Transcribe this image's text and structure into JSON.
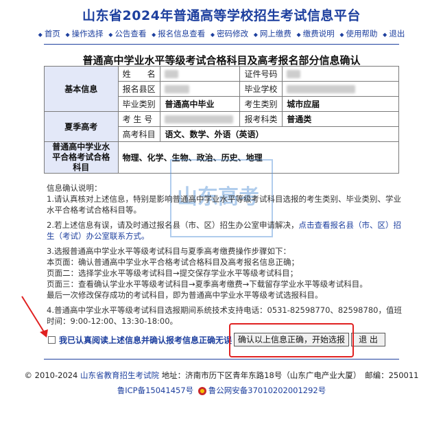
{
  "header": {
    "site_title": "山东省2024年普通高等学校招生考试信息平台",
    "nav": [
      "首页",
      "操作选择",
      "公告查看",
      "报名信息查看",
      "密码修改",
      "网上缴费",
      "缴费说明",
      "使用帮助",
      "退出"
    ]
  },
  "page_title": "普通高中学业水平等级考试合格科目及高考报名部分信息确认",
  "table": {
    "basic_section": "基本信息",
    "name_label": "姓　　名",
    "cert_label": "证件号码",
    "county_label": "报名县区",
    "school_label": "毕业学校",
    "grad_type_label": "毕业类别",
    "grad_type_value": "普通高中毕业",
    "exam_type_label": "考生类别",
    "exam_type_value": "城市应届",
    "summer_section": "夏季高考",
    "exam_no_label": "考 生 号",
    "subject_type_label": "报考科类",
    "subject_type_value": "普通类",
    "gaokao_subjects_label": "高考科目",
    "gaokao_subjects_value": "语文、数学、外语（英语）",
    "level_section": "普通高中学业水平合格考试合格科目",
    "level_subjects_value": "物理、化学、生物、政治、历史、地理"
  },
  "notes": {
    "title": "信息确认说明：",
    "n1": "1.请认真核对上述信息，特别是影响普通高中学业水平等级考试科目选报的考生类别、毕业类别、学业水平合格考试合格科目等。",
    "n2_text": "2.若上述信息有误，请及时通过报名县（市、区）招生办公室申请解决，",
    "n2_link": "点击查看报名县（市、区）招生（考试）办公室联系方式。",
    "n3_title": "3.选报普通高中学业水平等级考试科目与夏季高考缴费操作步骤如下：",
    "n3_p1": "本页面：确认普通高中学业水平合格考试合格科目及高考报名信息正确；",
    "n3_p2": "页面二：选择学业水平等级考试科目→提交保存学业水平等级考试科目；",
    "n3_p3": "页面三：查看确认学业水平等级考试科目→夏季高考缴费→下载留存学业水平等级考试科目。",
    "n3_p4": "最后一次修改保存成功的考试科目，即为普通高中学业水平等级考试选报科目。",
    "n4": "4.普通高中学业水平等级考试科目选报期间系统技术支持电话：0531-82598770、82598780，值班时间：9:00-12:00、13:30-18:00。"
  },
  "agree_text": "我已认真阅读上述信息并确认报考信息正确无误",
  "buttons": {
    "confirm": "确认以上信息正确，开始选报",
    "exit": "退 出"
  },
  "footer": {
    "copyright": "© 2010-2024",
    "org_link": "山东省教育招生考试院",
    "address": "地址：济南市历下区青年东路18号（山东广电产业大厦）　邮编：250011",
    "icp": "鲁ICP备15041457号",
    "police": "鲁公网安备37010202001292号"
  },
  "watermark_text": "山东高考",
  "colors": {
    "primary": "#1d3f9e",
    "section_bg": "#e3e8f8",
    "highlight_red": "#e02020"
  }
}
